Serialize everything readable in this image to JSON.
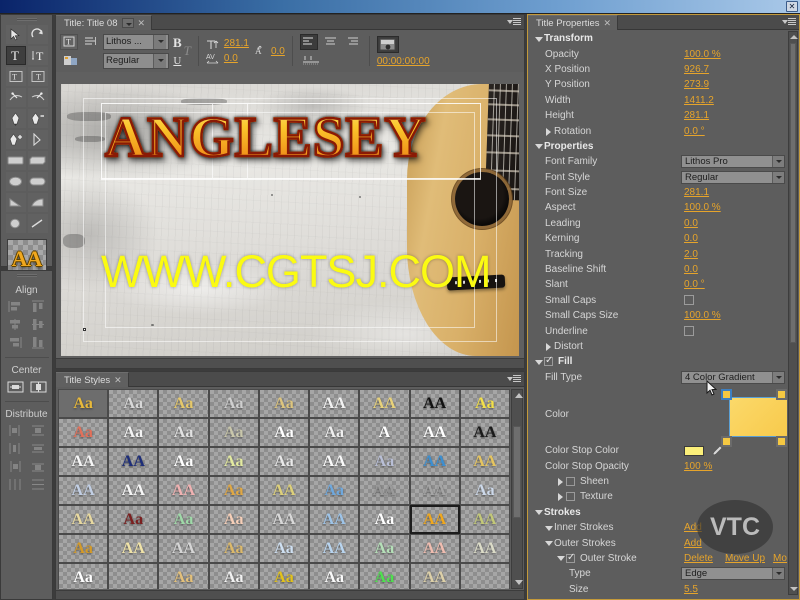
{
  "window": {
    "close_label": "✕"
  },
  "monitor": {
    "tab_label": "Title: Title 08",
    "tab_close": "✕",
    "toolbar": {
      "font_family": "Lithos ...",
      "font_style": "Regular",
      "bold": "B",
      "italic": "T",
      "underline": "U",
      "font_size": "281.1",
      "kerning": "0.0",
      "leading": "0.0",
      "tracking": "0.0",
      "timecode": "00:00:00:00"
    },
    "canvas": {
      "title_text": "ANGLESEY",
      "watermark": "WWW.CGTSJ.COM"
    }
  },
  "tools": {
    "items": [
      {
        "name": "selection-tool",
        "icon": "arrow"
      },
      {
        "name": "rotation-tool",
        "icon": "rotate"
      },
      {
        "name": "type-tool",
        "icon": "type-horizontal"
      },
      {
        "name": "vertical-type-tool",
        "icon": "type-vertical"
      },
      {
        "name": "area-type-tool",
        "icon": "area-type"
      },
      {
        "name": "vertical-area-type-tool",
        "icon": "vertical-area-type"
      },
      {
        "name": "path-type-tool",
        "icon": "path-type"
      },
      {
        "name": "vertical-path-type-tool",
        "icon": "vertical-path-type"
      },
      {
        "name": "pen-tool",
        "icon": "pen"
      },
      {
        "name": "delete-anchor-tool",
        "icon": "pen-minus"
      },
      {
        "name": "add-anchor-tool",
        "icon": "pen-plus"
      },
      {
        "name": "convert-anchor-tool",
        "icon": "convert-anchor"
      },
      {
        "name": "rectangle-tool",
        "icon": "rectangle"
      },
      {
        "name": "clipped-corner-rect-tool",
        "icon": "clipped-rect"
      },
      {
        "name": "rounded-rect-tool",
        "icon": "rounded-rect"
      },
      {
        "name": "rounded-corner-rect-tool",
        "icon": "round-rect-2"
      },
      {
        "name": "wedge-tool",
        "icon": "wedge"
      },
      {
        "name": "arc-tool",
        "icon": "arc"
      },
      {
        "name": "ellipse-tool",
        "icon": "ellipse"
      },
      {
        "name": "line-tool",
        "icon": "line"
      }
    ],
    "style_preview": "AA"
  },
  "align_panel": {
    "align_label": "Align",
    "center_label": "Center",
    "distribute_label": "Distribute",
    "align_buttons": [
      "align-left",
      "align-top",
      "align-horizontal-center",
      "align-vertical-center",
      "align-right",
      "align-bottom"
    ],
    "center_buttons": [
      "center-horizontally",
      "center-vertically"
    ],
    "distribute_buttons": [
      "distribute-left",
      "distribute-top",
      "distribute-center-h",
      "distribute-center-v",
      "distribute-right",
      "distribute-bottom",
      "distribute-even-h",
      "distribute-even-v"
    ]
  },
  "styles_panel": {
    "tab_label": "Title Styles",
    "tab_close": "✕",
    "selected_index": 43,
    "cells": [
      {
        "g": "Aa",
        "c": "#e8b93a",
        "bg": "#6d6d6d"
      },
      {
        "g": "Aa",
        "c": "#d8d8d8"
      },
      {
        "g": "Aa",
        "c": "#e5c86a"
      },
      {
        "g": "Aa",
        "c": "#cfcfcf"
      },
      {
        "g": "Aa",
        "c": "#ddc57e"
      },
      {
        "g": "AA",
        "c": "#f2f2f2"
      },
      {
        "g": "AA",
        "c": "#e8d27a"
      },
      {
        "g": "AA",
        "c": "#111111"
      },
      {
        "g": "Aa",
        "c": "#f3e04a"
      },
      {
        "g": "Aa",
        "c": "#e2705a"
      },
      {
        "g": "Aa",
        "c": "#f4f4f4"
      },
      {
        "g": "Aa",
        "c": "#e2e2e2"
      },
      {
        "g": "Aa",
        "c": "#c9c7ab"
      },
      {
        "g": "Aa",
        "c": "#ffffff"
      },
      {
        "g": "Aa",
        "c": "#efefef"
      },
      {
        "g": "A",
        "c": "#ffffff"
      },
      {
        "g": "AA",
        "c": "#ffffff"
      },
      {
        "g": "AA",
        "c": "#1a1a1a"
      },
      {
        "g": "AA",
        "c": "#f6f6f6"
      },
      {
        "g": "AA",
        "c": "#1d2d78"
      },
      {
        "g": "Aa",
        "c": "#ffffff"
      },
      {
        "g": "Aa",
        "c": "#e3eaa0"
      },
      {
        "g": "Aa",
        "c": "#e9e9e9"
      },
      {
        "g": "AA",
        "c": "#fafafa"
      },
      {
        "g": "Aa",
        "c": "#b9bfd6"
      },
      {
        "g": "AA",
        "c": "#3d8fd0"
      },
      {
        "g": "AA",
        "c": "#e6c560"
      },
      {
        "g": "AA",
        "c": "#c2cfe4"
      },
      {
        "g": "AA",
        "c": "#f7f7f7"
      },
      {
        "g": "AA",
        "c": "#f0b2b2"
      },
      {
        "g": "Aa",
        "c": "#e0a844"
      },
      {
        "g": "AA",
        "c": "#ddd07a"
      },
      {
        "g": "Aa",
        "c": "#6fa8dd"
      },
      {
        "g": "AA",
        "c": "#9a9a9a"
      },
      {
        "g": "AA",
        "c": "#a5a5a5"
      },
      {
        "g": "Aa",
        "c": "#cdd9ea"
      },
      {
        "g": "AA",
        "c": "#e8d9a0"
      },
      {
        "g": "Aa",
        "c": "#7a1f1f"
      },
      {
        "g": "Aa",
        "c": "#9fd9a8"
      },
      {
        "g": "Aa",
        "c": "#f6cfb8"
      },
      {
        "g": "AA",
        "c": "#d9d9d9"
      },
      {
        "g": "AA",
        "c": "#9ec4e8"
      },
      {
        "g": "Aa",
        "c": "#ffffff"
      },
      {
        "g": "AA",
        "c": "#f0a81e"
      },
      {
        "g": "AA",
        "c": "#c3c878"
      },
      {
        "g": "Aa",
        "c": "#d49a28"
      },
      {
        "g": "AA",
        "c": "#f0e3a8"
      },
      {
        "g": "AA",
        "c": "#d6d6d6"
      },
      {
        "g": "Aa",
        "c": "#dcb96a"
      },
      {
        "g": "Aa",
        "c": "#cfe0f2"
      },
      {
        "g": "AA",
        "c": "#b9d5f0"
      },
      {
        "g": "Aa",
        "c": "#b5e0b8"
      },
      {
        "g": "AA",
        "c": "#f0bdb0"
      },
      {
        "g": "AA",
        "c": "#dcdcc8"
      },
      {
        "g": "Aa",
        "c": "#ffffff"
      },
      {
        "g": "",
        "c": "#8e8e8e"
      },
      {
        "g": "Aa",
        "c": "#e3c07a"
      },
      {
        "g": "Aa",
        "c": "#f2f2f2"
      },
      {
        "g": "Aa",
        "c": "#e2c21a"
      },
      {
        "g": "Aa",
        "c": "#fafafa"
      },
      {
        "g": "Aa",
        "c": "#4fe04f"
      },
      {
        "g": "AA",
        "c": "#ddd0a8"
      },
      {
        "g": "",
        "c": "#8e8e8e"
      }
    ]
  },
  "properties_panel": {
    "tab_label": "Title Properties",
    "tab_close": "✕",
    "sections": {
      "transform": "Transform",
      "properties": "Properties",
      "fill": "Fill",
      "strokes": "Strokes"
    },
    "transform": [
      {
        "label": "Opacity",
        "value": "100.0 %"
      },
      {
        "label": "X Position",
        "value": "926.7"
      },
      {
        "label": "Y Position",
        "value": "273.9"
      },
      {
        "label": "Width",
        "value": "1411.2"
      },
      {
        "label": "Height",
        "value": "281.1"
      },
      {
        "label": "Rotation",
        "value": "0.0 °"
      }
    ],
    "properties": {
      "font_family_label": "Font Family",
      "font_family_value": "Lithos Pro",
      "font_style_label": "Font Style",
      "font_style_value": "Regular",
      "rows": [
        {
          "label": "Font Size",
          "value": "281.1"
        },
        {
          "label": "Aspect",
          "value": "100.0 %"
        },
        {
          "label": "Leading",
          "value": "0.0"
        },
        {
          "label": "Kerning",
          "value": "0.0"
        },
        {
          "label": "Tracking",
          "value": "2.0"
        },
        {
          "label": "Baseline Shift",
          "value": "0.0"
        },
        {
          "label": "Slant",
          "value": "0.0 °"
        }
      ],
      "small_caps_label": "Small Caps",
      "small_caps_size_label": "Small Caps Size",
      "small_caps_size_value": "100.0 %",
      "underline_label": "Underline",
      "distort_label": "Distort"
    },
    "fill": {
      "fill_label": "Fill",
      "fill_type_label": "Fill Type",
      "fill_type_value": "4 Color Gradient",
      "color_label": "Color",
      "color_stop_color_label": "Color Stop Color",
      "color_stop_opacity_label": "Color Stop Opacity",
      "color_stop_opacity_value": "100 %",
      "sheen_label": "Sheen",
      "texture_label": "Texture",
      "gradient_color": "#f5c842",
      "stop_color": "#fbef7a"
    },
    "strokes": {
      "inner_strokes_label": "Inner Strokes",
      "inner_add": "Add",
      "outer_strokes_label": "Outer Strokes",
      "outer_add": "Add",
      "outer_stroke_label": "Outer Stroke",
      "delete": "Delete",
      "move_up": "Move Up",
      "move_down": "Mov",
      "type_label": "Type",
      "type_value": "Edge",
      "size_label": "Size",
      "size_value": "5.5"
    }
  },
  "branding": {
    "vtc_logo": "VTC"
  },
  "colors": {
    "panel_bg": "#5d5d5d",
    "value_orange": "#e6a42b",
    "accent_border": "#c49a3a",
    "title_gold": "#f0a81e"
  }
}
